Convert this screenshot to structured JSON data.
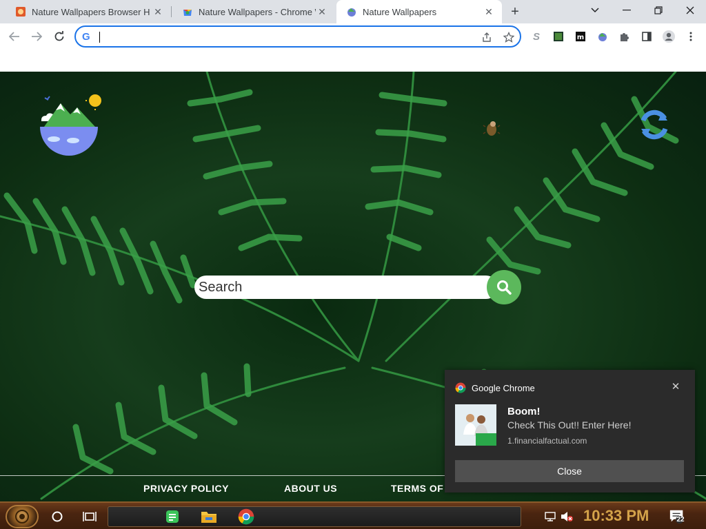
{
  "browser": {
    "tabs": [
      {
        "title": "Nature Wallpapers Browser H",
        "favicon": "nature-wallpapers-favicon",
        "active": false
      },
      {
        "title": "Nature Wallpapers - Chrome W",
        "favicon": "chrome-webstore-favicon",
        "active": false
      },
      {
        "title": "Nature Wallpapers",
        "favicon": "nature-wallpapers-logo-favicon",
        "active": true
      }
    ],
    "address_bar": {
      "value": "",
      "placeholder": ""
    }
  },
  "page": {
    "search": {
      "placeholder": "Search"
    },
    "footer_links": [
      "PRIVACY POLICY",
      "ABOUT US",
      "TERMS OF"
    ]
  },
  "notification": {
    "app": "Google Chrome",
    "title": "Boom!",
    "body": "Check This Out!! Enter Here!",
    "source": "1.financialfactual.com",
    "close_label": "Close"
  },
  "taskbar": {
    "clock": "10:33 PM",
    "notification_count": "22"
  },
  "colors": {
    "accent_blue": "#1a73e8",
    "search_button": "#5cb85c",
    "notification_bg": "#2b2b2b",
    "clock_color": "#d4a34a"
  }
}
